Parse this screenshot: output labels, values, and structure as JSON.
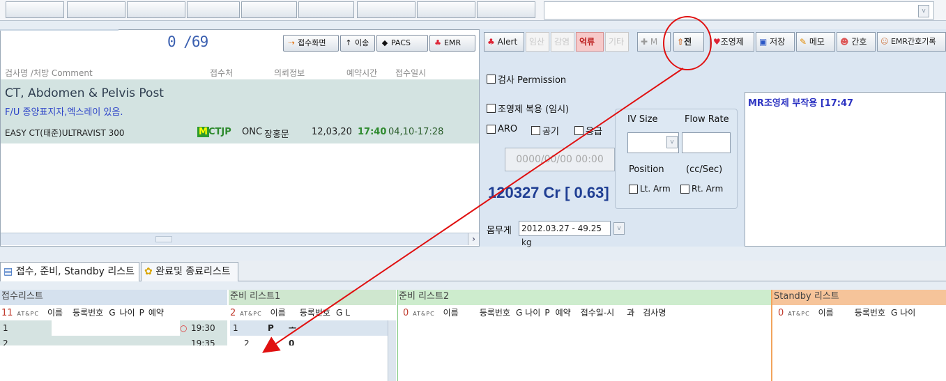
{
  "top_strip": {
    "dropdown_glyph": "v"
  },
  "left_panel": {
    "counter": "0 /69",
    "buttons": [
      {
        "label": "접수화면",
        "icon": "arrow-right-icon"
      },
      {
        "label": "이송",
        "icon": "arrow-up-icon"
      },
      {
        "label": "PACS",
        "icon": "pacs-icon"
      },
      {
        "label": "EMR",
        "icon": "emr-icon"
      }
    ],
    "columns": [
      "검사명 /처방 Comment",
      "접수처",
      "의뢰정보",
      "예약시간",
      "접수일시"
    ],
    "exam": {
      "title": "CT, Abdomen & Pelvis Post",
      "note": "F/U 종양표지자,엑스레이 있음.",
      "contrast": "EASY CT(태준)ULTRAVIST 300",
      "badge": "M",
      "code": "CTJP",
      "dept": "ONC",
      "doctor": "장홍문",
      "date": "12,03,20",
      "time": "17:40",
      "received": "04,10-17:28"
    },
    "scroll_arrow": "›"
  },
  "toolbar": {
    "items": [
      {
        "label": "Alert",
        "state": "normal",
        "icon": "alert-icon"
      },
      {
        "label": "임산",
        "state": "dim"
      },
      {
        "label": "감염",
        "state": "dim"
      },
      {
        "label": "억류",
        "state": "highlight"
      },
      {
        "label": "기타",
        "state": "dim"
      },
      {
        "label": "M",
        "state": "dim",
        "icon": "plus-icon"
      },
      {
        "label": "전",
        "state": "normal",
        "icon": "transfer-icon"
      },
      {
        "label": "조영제",
        "state": "normal",
        "icon": "contrast-icon"
      },
      {
        "label": "저장",
        "state": "normal",
        "icon": "save-icon"
      },
      {
        "label": "메모",
        "state": "normal",
        "icon": "memo-icon"
      },
      {
        "label": "간호",
        "state": "normal",
        "icon": "nurse-icon"
      },
      {
        "label": "EMR간호기록",
        "state": "normal",
        "icon": "emr-nursing-icon"
      }
    ]
  },
  "form": {
    "permission": "검사 Permission",
    "contrast_med": "조영제 복용 (임시)",
    "aro": "ARO",
    "fasting": "공기",
    "emergency": "응급",
    "datetime_placeholder": "0000/00/00 00:00",
    "cr_value": "120327 Cr [ 0.63]",
    "weight_label": "몸무게",
    "weight_value": "2012.03.27 - 49.25 kg"
  },
  "iv": {
    "size_label": "IV Size",
    "flow_label": "Flow Rate",
    "position_label": "Position",
    "unit_label": "(cc/Sec)",
    "lt_arm": "Lt. Arm",
    "rt_arm": "Rt. Arm"
  },
  "memo": {
    "text": "MR조영제 부작용  [17:47"
  },
  "tabs": [
    {
      "label": "접수, 준비, Standby 리스트",
      "icon": "list-icon"
    },
    {
      "label": "완료및 종료리스트",
      "icon": "paw-icon"
    }
  ],
  "lists": {
    "reception": {
      "title": "접수리스트",
      "count": "11",
      "columns": [
        "이름",
        "등록번호",
        "G",
        "나이",
        "P",
        "예약"
      ],
      "rows": [
        {
          "num": "1",
          "time": "19:30"
        },
        {
          "num": "2",
          "time": "19:35"
        }
      ]
    },
    "prep1": {
      "title": "준비 리스트1",
      "count": "2",
      "columns": [
        "이름",
        "등록번호",
        "G",
        "L"
      ],
      "rows": [
        {
          "num": "1",
          "p": "P",
          "mark": "ᅩ"
        },
        {
          "num": "2",
          "mark": "0"
        }
      ]
    },
    "prep2": {
      "title": "준비 리스트2",
      "count": "0",
      "columns": [
        "이름",
        "등록번호",
        "G",
        "나이",
        "P",
        "예약",
        "접수일-시",
        "과",
        "검사명"
      ]
    },
    "standby": {
      "title": "Standby 리스트",
      "count": "0",
      "columns": [
        "이름",
        "등록번호",
        "G",
        "나이"
      ]
    },
    "small_header": "AT&PC"
  },
  "colors": {
    "accent_blue": "#3a5fb0",
    "exam_bg": "#d3e3e1",
    "prep1_header": "#cfe7cf",
    "prep2_header": "#cdeccd",
    "standby_header": "#f6c49a",
    "annotation_red": "#e01010"
  }
}
